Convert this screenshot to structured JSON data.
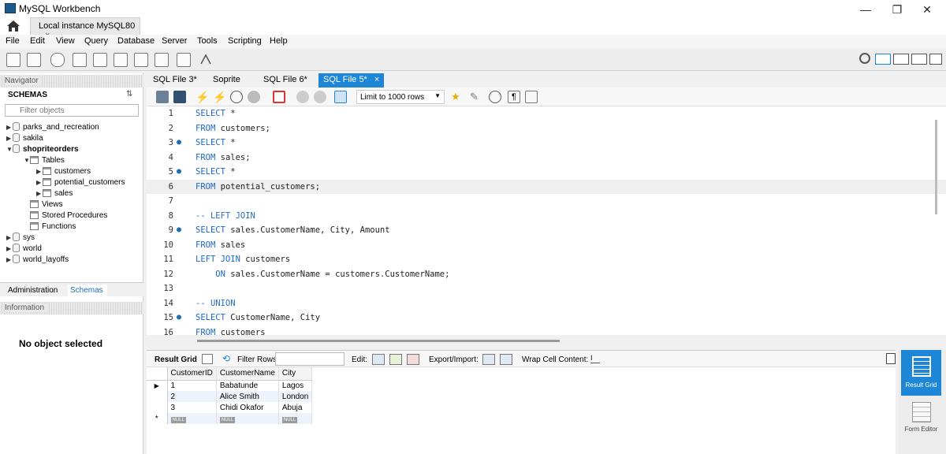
{
  "window": {
    "title": "MySQL Workbench",
    "min": "—",
    "max": "❐",
    "close": "✕"
  },
  "connection_tab": {
    "label": "Local instance MySQL80",
    "close": "×"
  },
  "menu": [
    "File",
    "Edit",
    "View",
    "Query",
    "Database",
    "Server",
    "Tools",
    "Scripting",
    "Help"
  ],
  "navigator": {
    "header": "Navigator",
    "schemas_label": "SCHEMAS",
    "filter_placeholder": "Filter objects",
    "tree": [
      {
        "label": "parks_and_recreation",
        "level": 0,
        "type": "db",
        "arrow": "▶"
      },
      {
        "label": "sakila",
        "level": 0,
        "type": "db",
        "arrow": "▶"
      },
      {
        "label": "shopriteorders",
        "level": 0,
        "type": "db",
        "arrow": "▼",
        "bold": true
      },
      {
        "label": "Tables",
        "level": 1,
        "type": "folder",
        "arrow": "▼"
      },
      {
        "label": "customers",
        "level": 2,
        "type": "table",
        "arrow": "▶"
      },
      {
        "label": "potential_customers",
        "level": 2,
        "type": "table",
        "arrow": "▶"
      },
      {
        "label": "sales",
        "level": 2,
        "type": "table",
        "arrow": "▶"
      },
      {
        "label": "Views",
        "level": 1,
        "type": "folder",
        "arrow": ""
      },
      {
        "label": "Stored Procedures",
        "level": 1,
        "type": "folder",
        "arrow": ""
      },
      {
        "label": "Functions",
        "level": 1,
        "type": "folder",
        "arrow": ""
      },
      {
        "label": "sys",
        "level": 0,
        "type": "db",
        "arrow": "▶"
      },
      {
        "label": "world",
        "level": 0,
        "type": "db",
        "arrow": "▶"
      },
      {
        "label": "world_layoffs",
        "level": 0,
        "type": "db",
        "arrow": "▶"
      }
    ],
    "tabs": {
      "admin": "Administration",
      "schemas": "Schemas"
    },
    "info_header": "Information",
    "no_object": "No object selected"
  },
  "editor_tabs": [
    {
      "label": "SQL File 3*",
      "active": false
    },
    {
      "label": "Soprite",
      "active": false
    },
    {
      "label": "SQL File 6*",
      "active": false
    },
    {
      "label": "SQL File 5*",
      "active": true,
      "close": "×"
    }
  ],
  "editor_toolbar": {
    "limit_label": "Limit to 1000 rows"
  },
  "code_lines": [
    {
      "n": "1",
      "dot": false,
      "tokens": [
        [
          "kw",
          "SELECT"
        ],
        [
          "plain",
          " *"
        ]
      ]
    },
    {
      "n": "2",
      "dot": false,
      "tokens": [
        [
          "kw",
          "FROM"
        ],
        [
          "plain",
          " customers;"
        ]
      ]
    },
    {
      "n": "3",
      "dot": true,
      "tokens": [
        [
          "kw",
          "SELECT"
        ],
        [
          "plain",
          " *"
        ]
      ]
    },
    {
      "n": "4",
      "dot": false,
      "tokens": [
        [
          "kw",
          "FROM"
        ],
        [
          "plain",
          " sales;"
        ]
      ]
    },
    {
      "n": "5",
      "dot": true,
      "tokens": [
        [
          "kw",
          "SELECT"
        ],
        [
          "plain",
          " *"
        ]
      ]
    },
    {
      "n": "6",
      "dot": false,
      "hl": true,
      "tokens": [
        [
          "kw",
          "FROM"
        ],
        [
          "plain",
          " potential_customers;"
        ]
      ]
    },
    {
      "n": "7",
      "dot": false,
      "tokens": []
    },
    {
      "n": "8",
      "dot": false,
      "tokens": [
        [
          "cm",
          "-- LEFT JOIN"
        ]
      ]
    },
    {
      "n": "9",
      "dot": true,
      "tokens": [
        [
          "kw",
          "SELECT"
        ],
        [
          "plain",
          " sales.CustomerName, City, Amount"
        ]
      ]
    },
    {
      "n": "10",
      "dot": false,
      "tokens": [
        [
          "kw",
          "FROM"
        ],
        [
          "plain",
          " sales"
        ]
      ]
    },
    {
      "n": "11",
      "dot": false,
      "tokens": [
        [
          "kw",
          "LEFT JOIN"
        ],
        [
          "plain",
          " customers"
        ]
      ]
    },
    {
      "n": "12",
      "dot": false,
      "tokens": [
        [
          "plain",
          "    "
        ],
        [
          "kw",
          "ON"
        ],
        [
          "plain",
          " sales.CustomerName = customers.CustomerName;"
        ]
      ]
    },
    {
      "n": "13",
      "dot": false,
      "tokens": []
    },
    {
      "n": "14",
      "dot": false,
      "tokens": [
        [
          "cm",
          "-- UNION"
        ]
      ]
    },
    {
      "n": "15",
      "dot": true,
      "tokens": [
        [
          "kw",
          "SELECT"
        ],
        [
          "plain",
          " CustomerName, City"
        ]
      ]
    },
    {
      "n": "16",
      "dot": false,
      "tokens": [
        [
          "kw",
          "FROM"
        ],
        [
          "plain",
          " customers"
        ]
      ]
    }
  ],
  "result_toolbar": {
    "result_grid": "Result Grid",
    "filter_rows": "Filter Rows:",
    "edit": "Edit:",
    "export_import": "Export/Import:",
    "wrap_cell": "Wrap Cell Content:"
  },
  "result": {
    "columns": [
      "CustomerID",
      "CustomerName",
      "City"
    ],
    "rows": [
      [
        "1",
        "Babatunde",
        "Lagos"
      ],
      [
        "2",
        "Alice Smith",
        "London"
      ],
      [
        "3",
        "Chidi Okafor",
        "Abuja"
      ]
    ],
    "null_label": "NULL"
  },
  "side_panel": {
    "result_grid": "Result Grid",
    "form_editor": "Form Editor"
  },
  "colors": {
    "accent": "#1e86d6",
    "keyword": "#1a67c8"
  }
}
